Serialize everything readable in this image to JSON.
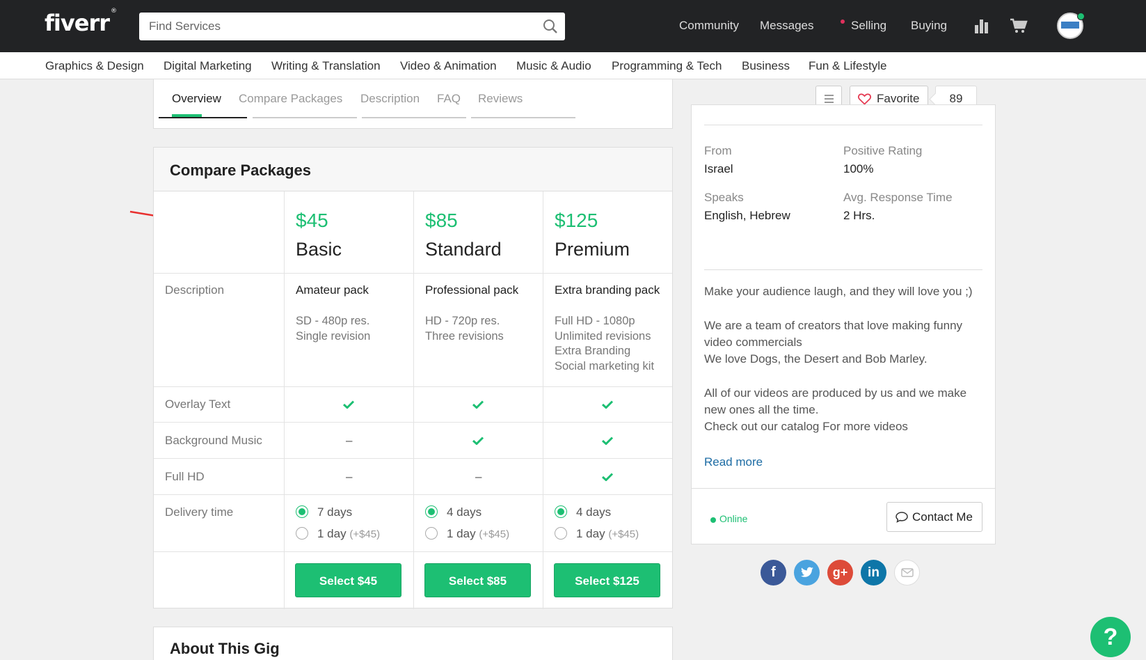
{
  "brand": {
    "logo": "fiverr",
    "mark": "®"
  },
  "search": {
    "placeholder": "Find Services"
  },
  "topnav": [
    "Community",
    "Messages",
    "Selling",
    "Buying"
  ],
  "categories": [
    "Graphics & Design",
    "Digital Marketing",
    "Writing & Translation",
    "Video & Animation",
    "Music & Audio",
    "Programming & Tech",
    "Business",
    "Fun & Lifestyle"
  ],
  "subnav": {
    "tabs": [
      "Overview",
      "Compare Packages",
      "Description",
      "FAQ",
      "Reviews"
    ],
    "active": "Overview"
  },
  "favorite": {
    "label": "Favorite",
    "count": "89"
  },
  "compare": {
    "title": "Compare Packages",
    "row_labels": [
      "Description",
      "Overlay Text",
      "Background Music",
      "Full HD",
      "Delivery time"
    ],
    "packages": [
      {
        "price": "$45",
        "name": "Basic",
        "desc_title": "Amateur pack",
        "desc_lines": [
          "SD - 480p res.",
          "Single revision"
        ],
        "features": [
          "check",
          "dash",
          "dash"
        ],
        "delivery": {
          "option1": "7 days",
          "option2": "1 day",
          "option2_extra": "(+$45)",
          "selected": 1
        },
        "button": "Select $45"
      },
      {
        "price": "$85",
        "name": "Standard",
        "desc_title": "Professional pack",
        "desc_lines": [
          "HD - 720p res.",
          "Three revisions"
        ],
        "features": [
          "check",
          "check",
          "dash"
        ],
        "delivery": {
          "option1": "4 days",
          "option2": "1 day",
          "option2_extra": "(+$45)",
          "selected": 1
        },
        "button": "Select $85"
      },
      {
        "price": "$125",
        "name": "Premium",
        "desc_title": "Extra branding pack",
        "desc_lines": [
          "Full HD - 1080p",
          "Unlimited revisions",
          "Extra Branding",
          "Social marketing kit"
        ],
        "features": [
          "check",
          "check",
          "check"
        ],
        "delivery": {
          "option1": "4 days",
          "option2": "1 day",
          "option2_extra": "(+$45)",
          "selected": 1
        },
        "button": "Select $125"
      }
    ]
  },
  "about": {
    "title": "About This Gig"
  },
  "seller": {
    "from_label": "From",
    "from": "Israel",
    "rating_label": "Positive Rating",
    "rating": "100%",
    "speaks_label": "Speaks",
    "speaks": "English, Hebrew",
    "response_label": "Avg. Response Time",
    "response": "2 Hrs.",
    "bio": [
      "Make your audience laugh, and they will love you ;)",
      "We are a team of creators that love making funny",
      "video commercials",
      "We love Dogs, the Desert and Bob Marley.",
      "All of our videos are produced by us and we make",
      "new ones all the time.",
      "Check out our catalog For more videos"
    ],
    "read_more": "Read more",
    "status": "Online",
    "contact": "Contact Me"
  },
  "social": {
    "facebook": "f",
    "googleplus": "g+",
    "linkedin": "in"
  },
  "help": "?",
  "colors": {
    "accent": "#1dbf73",
    "topbar": "#222325",
    "link": "#1d6ca4",
    "arrow": "#e8302f"
  }
}
